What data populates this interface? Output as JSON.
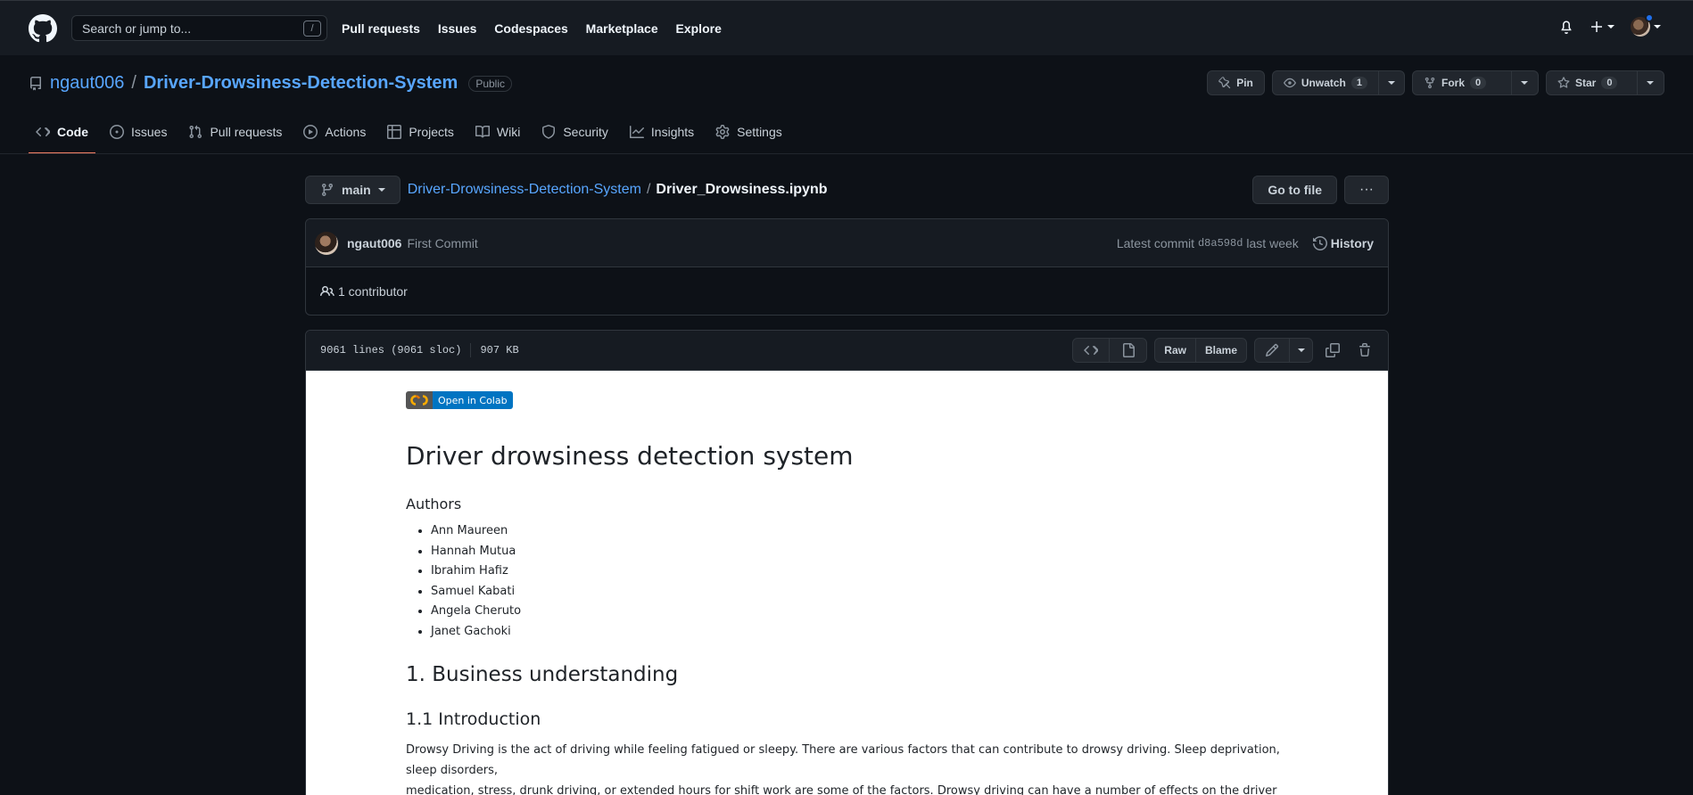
{
  "header": {
    "search_placeholder": "Search or jump to...",
    "search_key": "/",
    "nav": [
      "Pull requests",
      "Issues",
      "Codespaces",
      "Marketplace",
      "Explore"
    ]
  },
  "repo": {
    "owner": "ngaut006",
    "separator": "/",
    "name": "Driver-Drowsiness-Detection-System",
    "visibility": "Public",
    "pin_label": "Pin",
    "unwatch_label": "Unwatch",
    "watch_count": "1",
    "fork_label": "Fork",
    "fork_count": "0",
    "star_label": "Star",
    "star_count": "0"
  },
  "tabs": [
    {
      "label": "Code",
      "icon": "code-icon",
      "active": true
    },
    {
      "label": "Issues",
      "icon": "issue-icon"
    },
    {
      "label": "Pull requests",
      "icon": "pull-request-icon"
    },
    {
      "label": "Actions",
      "icon": "play-icon"
    },
    {
      "label": "Projects",
      "icon": "table-icon"
    },
    {
      "label": "Wiki",
      "icon": "book-icon"
    },
    {
      "label": "Security",
      "icon": "shield-icon"
    },
    {
      "label": "Insights",
      "icon": "graph-icon"
    },
    {
      "label": "Settings",
      "icon": "gear-icon"
    }
  ],
  "file": {
    "branch": "main",
    "repo_link": "Driver-Drowsiness-Detection-System",
    "separator": "/",
    "filename": "Driver_Drowsiness.ipynb",
    "go_to_file": "Go to file",
    "more": "···"
  },
  "commit": {
    "author": "ngaut006",
    "message": "First Commit",
    "latest_label": "Latest commit",
    "sha": "d8a598d",
    "when": "last week",
    "history": "History",
    "contributors": "1 contributor"
  },
  "blob": {
    "lines": "9061 lines (9061 sloc)",
    "size": "907 KB",
    "raw": "Raw",
    "blame": "Blame"
  },
  "notebook": {
    "colab_badge": "Open in Colab",
    "title": "Driver drowsiness detection system",
    "authors_heading": "Authors",
    "authors": [
      "Ann Maureen",
      "Hannah Mutua",
      "Ibrahim Hafiz",
      "Samuel Kabati",
      "Angela Cheruto",
      "Janet Gachoki"
    ],
    "section1": "1. Business understanding",
    "section1_1": "1.1 Introduction",
    "intro_line1": "Drowsy Driving is the act of driving while feeling fatigued or sleepy. There are various factors that can contribute to drowsy driving. Sleep deprivation, sleep disorders,",
    "intro_line2": "medication, stress, drunk driving, or extended hours for shift work are some of the factors. Drowsy driving can have a number of effects on the driver such as poor"
  },
  "colors": {
    "accent_tab": "#f78166",
    "link": "#58a6ff",
    "bg": "#0d1117",
    "header_bg": "#161b22",
    "colab_blue": "#0074c2"
  }
}
